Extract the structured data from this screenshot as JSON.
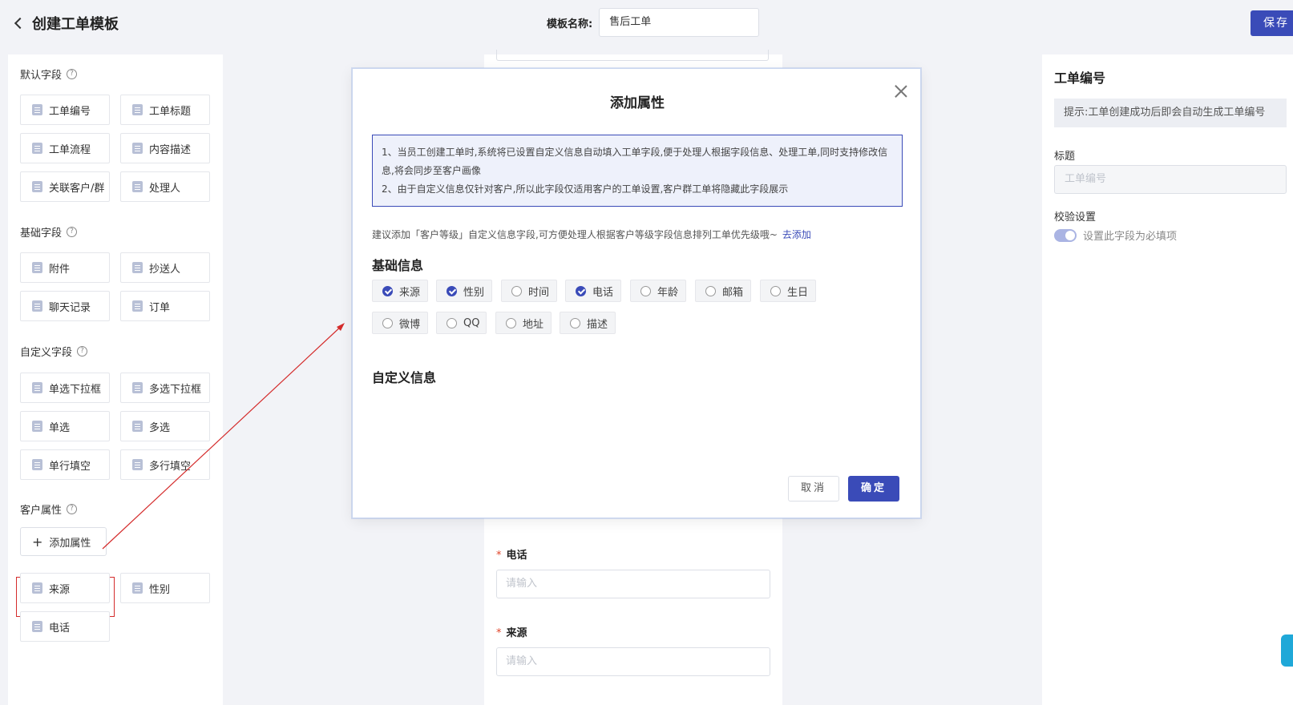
{
  "header": {
    "title": "创建工单模板",
    "template_name_label": "模板名称:",
    "template_name_value": "售后工单",
    "save_label": "保存"
  },
  "sidebar": {
    "default_section": "默认字段",
    "default_fields": [
      "工单编号",
      "工单标题",
      "工单流程",
      "内容描述",
      "关联客户/群",
      "处理人"
    ],
    "basic_section": "基础字段",
    "basic_fields": [
      "附件",
      "抄送人",
      "聊天记录",
      "订单"
    ],
    "custom_section": "自定义字段",
    "custom_fields": [
      "单选下拉框",
      "多选下拉框",
      "单选",
      "多选",
      "单行填空",
      "多行填空"
    ],
    "customer_section": "客户属性",
    "add_attr_label": "添加属性",
    "customer_fields": [
      "来源",
      "性别",
      "电话"
    ]
  },
  "canvas": {
    "fields": [
      {
        "label": "电话",
        "placeholder": "请输入"
      },
      {
        "label": "来源",
        "placeholder": "请输入"
      }
    ]
  },
  "right_panel": {
    "title": "工单编号",
    "tip": "提示:工单创建成功后即会自动生成工单编号",
    "title_label": "标题",
    "title_placeholder": "工单编号",
    "validate_label": "校验设置",
    "required_switch_label": "设置此字段为必填项",
    "required_switch_on": true
  },
  "modal": {
    "title": "添加属性",
    "notice_1": "1、当员工创建工单时,系统将已设置自定义信息自动填入工单字段,便于处理人根据字段信息、处理工单,同时支持修改信息,将会同步至客户画像",
    "notice_2": "2、由于自定义信息仅针对客户,所以此字段仅适用客户的工单设置,客户群工单将隐藏此字段展示",
    "suggestion": "建议添加「客户等级」自定义信息字段,可方便处理人根据客户等级字段信息排列工单优先级哦~",
    "suggestion_link": "去添加",
    "basic_info_title": "基础信息",
    "options": [
      {
        "label": "来源",
        "checked": true
      },
      {
        "label": "性别",
        "checked": true
      },
      {
        "label": "时间",
        "checked": false
      },
      {
        "label": "电话",
        "checked": true
      },
      {
        "label": "年龄",
        "checked": false
      },
      {
        "label": "邮箱",
        "checked": false
      },
      {
        "label": "生日",
        "checked": false
      },
      {
        "label": "微博",
        "checked": false
      },
      {
        "label": "QQ",
        "checked": false
      },
      {
        "label": "地址",
        "checked": false
      },
      {
        "label": "描述",
        "checked": false
      }
    ],
    "custom_info_title": "自定义信息",
    "cancel_label": "取消",
    "confirm_label": "确定"
  },
  "colors": {
    "primary": "#3a4bb8",
    "annotation_red": "#d42b2b",
    "required_star": "#e0452a"
  }
}
